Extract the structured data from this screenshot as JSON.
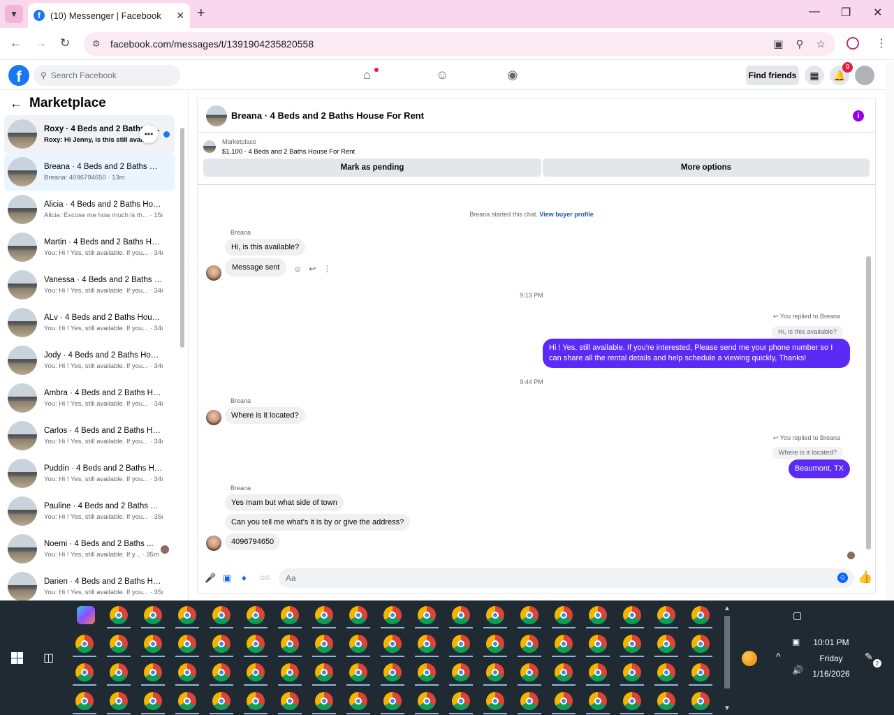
{
  "browser": {
    "tab_title": "(10) Messenger | Facebook",
    "url": "facebook.com/messages/t/1391904235820558"
  },
  "fb": {
    "search_placeholder": "Search Facebook",
    "find_friends": "Find friends",
    "notification_count": "9"
  },
  "sidebar": {
    "title": "Marketplace",
    "conversations": [
      {
        "name": "Roxy · 4 Beds and 2 Baths H...",
        "preview": "Roxy: Hi Jenny, is this still avail..."
      },
      {
        "name": "Breana · 4 Beds and 2 Baths Ho...",
        "preview": "Breana: 4096794650 · 13m"
      },
      {
        "name": "Alicia · 4 Beds and 2 Baths Hou...",
        "preview": "Alicia: Excuse me how much is th... · 15m"
      },
      {
        "name": "Martin · 4 Beds and 2 Baths Ho...",
        "preview": "You: Hi ! Yes, still available. If you... · 34m"
      },
      {
        "name": "Vanessa · 4 Beds and 2 Baths H...",
        "preview": "You: Hi ! Yes, still available. If you... · 34m"
      },
      {
        "name": "ALv · 4 Beds and 2 Baths House...",
        "preview": "You: Hi ! Yes, still available. If you... · 34m"
      },
      {
        "name": "Jody · 4 Beds and 2 Baths Hous...",
        "preview": "You: Hi ! Yes, still available. If you... · 34m"
      },
      {
        "name": "Ambra · 4 Beds and 2 Baths Ho...",
        "preview": "You: Hi ! Yes, still available. If you... · 34m"
      },
      {
        "name": "Carlos · 4 Beds and 2 Baths Ho...",
        "preview": "You: Hi ! Yes, still available. If you... · 34m"
      },
      {
        "name": "Puddin · 4 Beds and 2 Baths Ho...",
        "preview": "You: Hi ! Yes, still available. If you... · 34m"
      },
      {
        "name": "Pauline · 4 Beds and 2 Baths Ho...",
        "preview": "You: Hi ! Yes, still available. If you... · 35m"
      },
      {
        "name": "Noemi · 4 Beds and 2 Baths ...",
        "preview": "You: Hi ! Yes, still available. If y... · 35m"
      },
      {
        "name": "Darien · 4 Beds and 2 Baths Ho...",
        "preview": "You: Hi ! Yes, still available. If you... · 35m"
      }
    ]
  },
  "chat": {
    "title": "Breana · 4 Beds and 2 Baths House For Rent",
    "marketplace_label": "Marketplace",
    "listing": "$1,100 - 4 Beds and 2 Baths House For Rent",
    "mark_pending": "Mark as pending",
    "more_options": "More options",
    "started_text": "Breana started this chat.",
    "view_profile": "View buyer profile",
    "sender_name": "Breana",
    "msg1": "Hi, is this available?",
    "msg2": "Message sent",
    "time1": "9:13 PM",
    "reply_note": "You replied to Breana",
    "quote1": "Hi, is this available?",
    "out1": "Hi ! Yes, still available. If you're interested, Please send me your phone number so I can share all the rental details and help schedule a viewing quickly, Thanks!",
    "time2": "9:44 PM",
    "msg3": "Where is it located?",
    "quote2": "Where is it located?",
    "out2": "Beaumont, TX",
    "msg4": "Yes mam but what side of town",
    "msg5": "Can you tell me what's it is by or give the address?",
    "msg6": "4096794650",
    "composer_placeholder": "Aa"
  },
  "taskbar": {
    "time": "10:01 PM",
    "day": "Friday",
    "date": "1/16/2026",
    "notif_count": "2"
  }
}
